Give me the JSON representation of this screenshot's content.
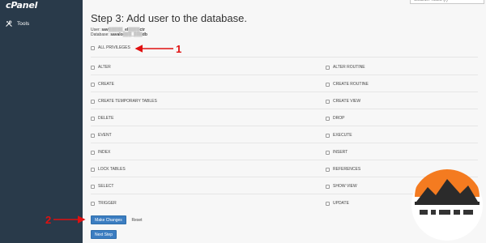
{
  "sidebar": {
    "logo": "cPanel",
    "items": [
      {
        "label": "Tools",
        "icon": "tools-icon"
      }
    ]
  },
  "search": {
    "placeholder": "Search Tools (/)"
  },
  "page": {
    "title": "Step 3: Add user to the database.",
    "user_label": "User:",
    "user_value": "sav▒▒▒▒▒_el▒▒▒▒ctr",
    "database_label": "Database:",
    "database_value": "savalo▒▒▒_▒▒▒db"
  },
  "privileges": {
    "all": "ALL PRIVILEGES",
    "rows": [
      {
        "left": "ALTER",
        "right": "ALTER ROUTINE"
      },
      {
        "left": "CREATE",
        "right": "CREATE ROUTINE"
      },
      {
        "left": "CREATE TEMPORARY TABLES",
        "right": "CREATE VIEW"
      },
      {
        "left": "DELETE",
        "right": "DROP"
      },
      {
        "left": "EVENT",
        "right": "EXECUTE"
      },
      {
        "left": "INDEX",
        "right": "INSERT"
      },
      {
        "left": "LOCK TABLES",
        "right": "REFERENCES"
      },
      {
        "left": "SELECT",
        "right": "SHOW VIEW"
      },
      {
        "left": "TRIGGER",
        "right": "UPDATE"
      }
    ]
  },
  "buttons": {
    "make_changes": "Make Changes",
    "reset": "Reset",
    "next_step": "Next Step"
  },
  "annotations": {
    "marker_1": "1",
    "marker_2": "2",
    "color": "#e01010"
  },
  "colors": {
    "sidebar": "#293a4a",
    "primary_button": "#3b7dc1",
    "logo_accent": "#ff6c2c"
  }
}
